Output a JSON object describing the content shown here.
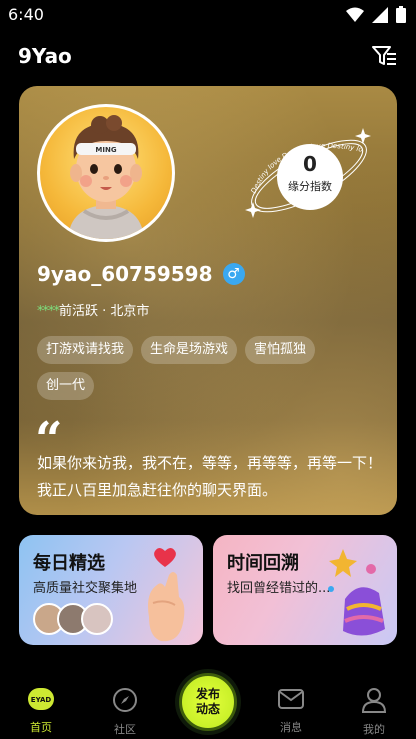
{
  "status_bar": {
    "time": "6:40"
  },
  "header": {
    "title": "9Yao"
  },
  "profile": {
    "avatar_badge": "MING",
    "fate_index": {
      "value": "0",
      "label": "缘分指数",
      "orbit_text": "Destiny love Destiny love Destiny love"
    },
    "username": "9yao_60759598",
    "gender_symbol": "♂",
    "activity_dots": "****",
    "activity_text": "前活跃 · 北京市",
    "tags": [
      "打游戏请找我",
      "生命是场游戏",
      "害怕孤独",
      "创一代"
    ],
    "quote_mark": "“",
    "bio": "如果你来访我，我不在，等等，再等等，再等一下！我正八百里加急赶往你的聊天界面。"
  },
  "features": [
    {
      "title": "每日精选",
      "subtitle": "高质量社交聚集地"
    },
    {
      "title": "时间回溯",
      "subtitle": "找回曾经错过的..."
    }
  ],
  "bottom_nav": {
    "items": [
      {
        "label": "首页",
        "icon": "home-logo-icon",
        "active": true
      },
      {
        "label": "社区",
        "icon": "compass-icon",
        "active": false
      },
      {
        "label": "消息",
        "icon": "mail-icon",
        "active": false
      },
      {
        "label": "我的",
        "icon": "person-icon",
        "active": false
      }
    ],
    "publish": {
      "line1": "发布",
      "line2": "动态"
    },
    "home_logo_text": "EYAD"
  },
  "colors": {
    "accent": "#cde832",
    "gender": "#3aa8f0",
    "active_dots": "#7de07d"
  }
}
